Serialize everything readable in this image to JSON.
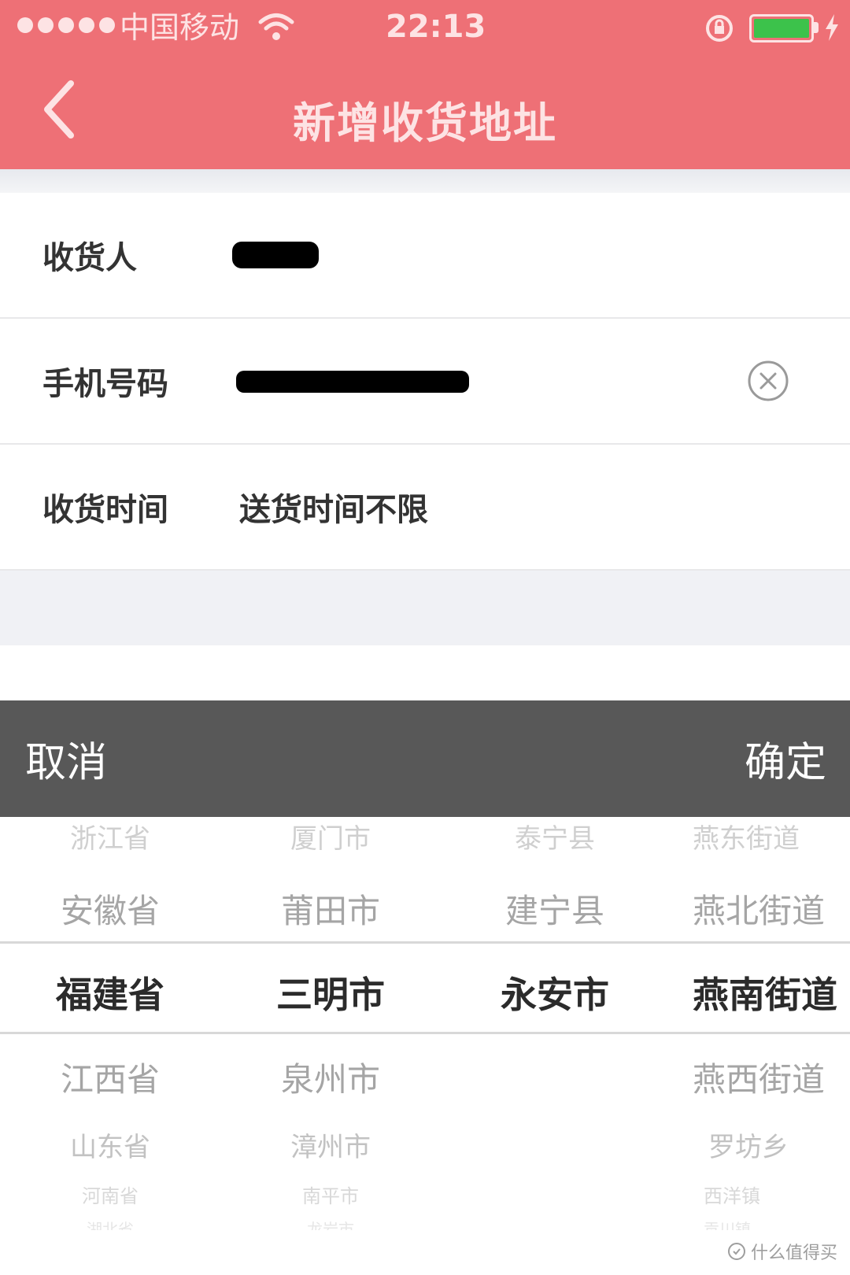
{
  "status_bar": {
    "carrier": "中国移动",
    "time": "22:13",
    "battery_level": 1.0,
    "battery_color": "#3cc24b"
  },
  "nav": {
    "back_icon": "chevron-left-icon",
    "title": "新增收货地址",
    "background": "#ee7076"
  },
  "form": {
    "rows": [
      {
        "label": "收货人",
        "value_redacted": true
      },
      {
        "label": "手机号码",
        "value_redacted": true,
        "clear_icon": "clear-circle-x-icon"
      },
      {
        "label": "收货时间",
        "value": "送货时间不限"
      }
    ]
  },
  "picker": {
    "toolbar": {
      "cancel": "取消",
      "confirm": "确定",
      "background": "#585858"
    },
    "columns": [
      {
        "options": [
          "浙江省",
          "安徽省",
          "福建省",
          "江西省",
          "山东省",
          "河南省",
          "湖北省"
        ],
        "selected": "福建省"
      },
      {
        "options": [
          "厦门市",
          "莆田市",
          "三明市",
          "泉州市",
          "漳州市",
          "南平市",
          "龙岩市"
        ],
        "selected": "三明市"
      },
      {
        "options": [
          "泰宁县",
          "建宁县",
          "永安市",
          "",
          "",
          "",
          ""
        ],
        "selected": "永安市"
      },
      {
        "options": [
          "燕东街道",
          "燕北街道",
          "燕南街道",
          "燕西街道",
          "罗坊乡",
          "西洋镇",
          "贡川镇"
        ],
        "selected": "燕南街道"
      }
    ]
  },
  "watermark": {
    "text": "什么值得买"
  }
}
